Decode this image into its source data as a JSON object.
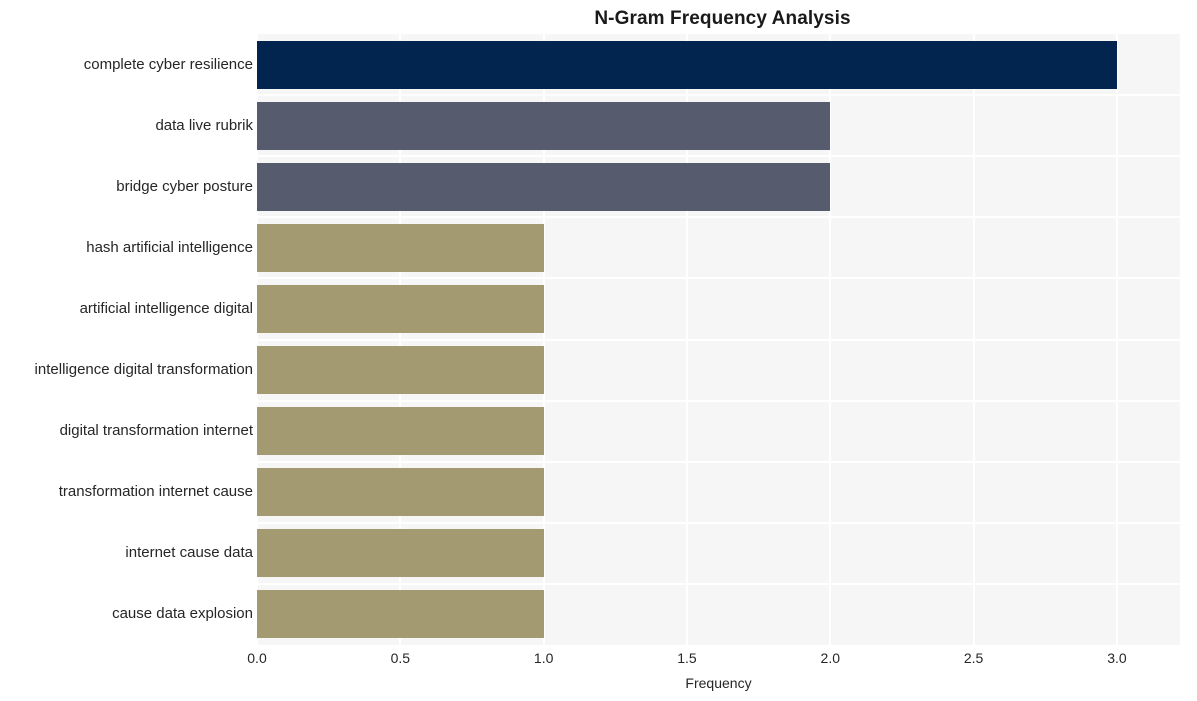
{
  "chart_data": {
    "type": "bar",
    "orientation": "horizontal",
    "title": "N-Gram Frequency Analysis",
    "xlabel": "Frequency",
    "ylabel": "",
    "xlim": [
      0,
      3.22
    ],
    "xticks": [
      "0.0",
      "0.5",
      "1.0",
      "1.5",
      "2.0",
      "2.5",
      "3.0"
    ],
    "xtick_values": [
      0.0,
      0.5,
      1.0,
      1.5,
      2.0,
      2.5,
      3.0
    ],
    "grid": true,
    "legend": "none",
    "categories": [
      "complete cyber resilience",
      "data live rubrik",
      "bridge cyber posture",
      "hash artificial intelligence",
      "artificial intelligence digital",
      "intelligence digital transformation",
      "digital transformation internet",
      "transformation internet cause",
      "internet cause data",
      "cause data explosion"
    ],
    "values": [
      3,
      2,
      2,
      1,
      1,
      1,
      1,
      1,
      1,
      1
    ],
    "bar_colors": [
      "#02254f",
      "#565b6e",
      "#565b6e",
      "#a39a72",
      "#a39a72",
      "#a39a72",
      "#a39a72",
      "#a39a72",
      "#a39a72",
      "#a39a72"
    ],
    "plot_background": "#f6f6f7",
    "grid_color": "#ffffff",
    "figure_background": "#ffffff"
  }
}
